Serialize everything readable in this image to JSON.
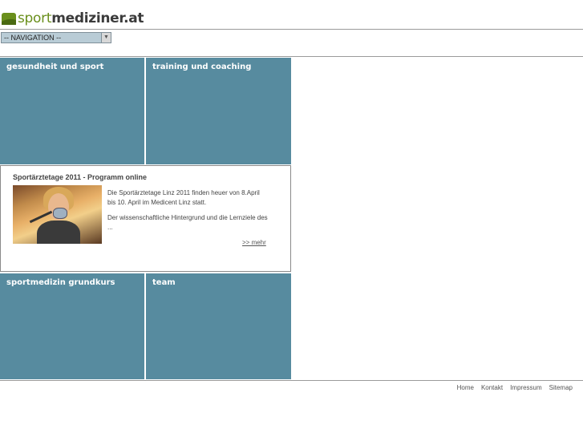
{
  "logo": {
    "part_a": "sport",
    "part_b": "mediziner.at"
  },
  "nav": {
    "select_value": "-- NAVIGATION --",
    "arrow_icon": "chevron-down-icon"
  },
  "tiles": [
    {
      "title": "gesundheit und sport"
    },
    {
      "title": "training und coaching"
    },
    {
      "title": "sportmedizin grundkurs"
    },
    {
      "title": "team"
    }
  ],
  "news": {
    "title": "Sportärztetage 2011 - Programm online",
    "paragraph1": "Die Sportärztetage Linz 2011 finden heuer von 8.April bis 10. April im Medicent Linz statt.",
    "paragraph2": "Der wissenschaftliche Hintergrund und die Lernziele des ...",
    "more_label": ">> mehr"
  },
  "footer": {
    "links": [
      "Home",
      "Kontakt",
      "Impressum",
      "Sitemap"
    ]
  },
  "colors": {
    "tile": "#578b9f",
    "brand_green": "#6a8f1c",
    "select_bg": "#b9ccd6"
  }
}
